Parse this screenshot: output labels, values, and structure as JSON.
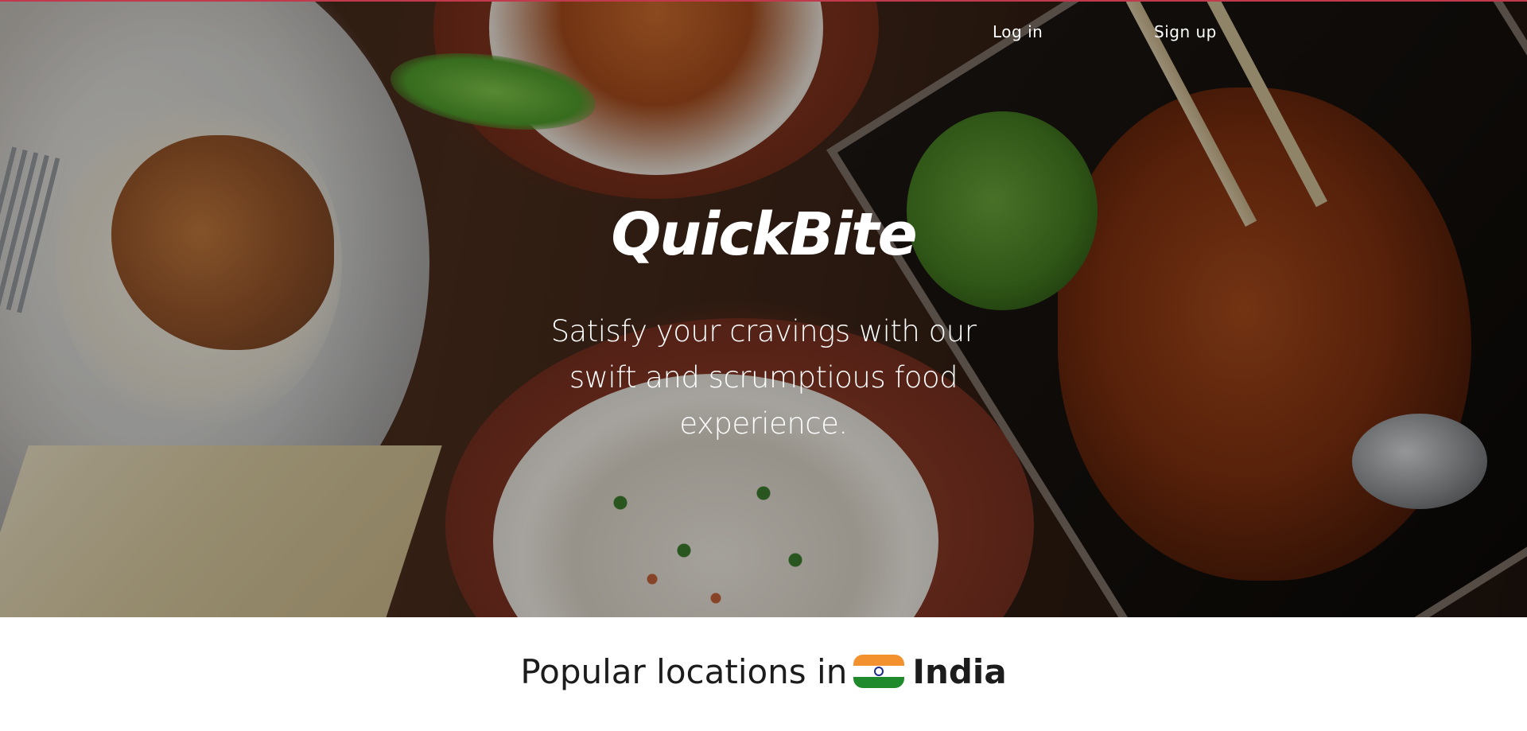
{
  "header": {
    "login_label": "Log in",
    "signup_label": "Sign up"
  },
  "hero": {
    "brand": "QuickBite",
    "tagline": "Satisfy your cravings with our swift and scrumptious food experience."
  },
  "popular": {
    "prefix": "Popular locations in",
    "flag_icon": "india-flag-icon",
    "country": "India"
  },
  "colors": {
    "accent_line": "#c0394d",
    "text_dark": "#1c1c1c",
    "hero_text": "#ffffff"
  }
}
